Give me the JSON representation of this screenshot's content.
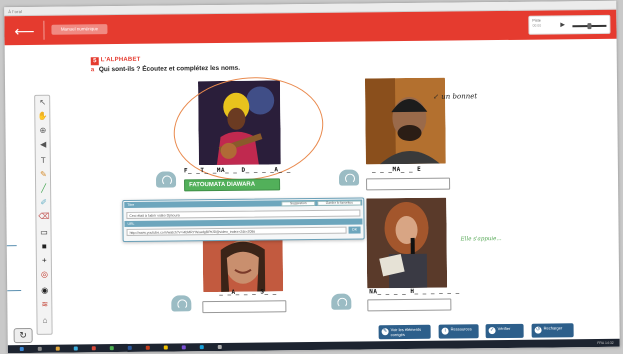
{
  "window": {
    "titlebar_text": "À l'oral"
  },
  "appbar": {
    "back_label": "⟵",
    "nav_chip_label": "Manuel numérique",
    "media": {
      "label_top": "Piste",
      "label_bottom": "00:00",
      "play": "▶"
    }
  },
  "toolbar": {
    "tools": [
      {
        "name": "cursor-icon",
        "glyph": "↖"
      },
      {
        "name": "hand-icon",
        "glyph": "✋"
      },
      {
        "name": "zoom-icon",
        "glyph": "⊕"
      },
      {
        "name": "speaker-tool-icon",
        "glyph": "◀"
      },
      {
        "name": "text-icon",
        "glyph": "T"
      },
      {
        "name": "pencil-icon",
        "glyph": "✎"
      },
      {
        "name": "marker-icon",
        "glyph": "╱"
      },
      {
        "name": "highlighter-icon",
        "glyph": "✐"
      },
      {
        "name": "eraser-icon",
        "glyph": "⌫"
      },
      {
        "name": "screen-icon",
        "glyph": "▭"
      },
      {
        "name": "square-icon",
        "glyph": "■"
      },
      {
        "name": "plus-icon",
        "glyph": "+"
      },
      {
        "name": "target-icon",
        "glyph": "◎"
      },
      {
        "name": "eye-icon",
        "glyph": "◉"
      },
      {
        "name": "mask-icon",
        "glyph": "≋"
      },
      {
        "name": "save-icon",
        "glyph": "⌂"
      }
    ]
  },
  "exercise": {
    "number": "5",
    "title": "L'ALPHABET",
    "arrow": "a",
    "instruction": "Qui sont-ils ? Écoutez et complétez les noms."
  },
  "cards": [
    {
      "dashed": "F_ _T_ _MA_ _ D_ _ _ _A_ _",
      "answer": "FATOUMATA DIAWARA",
      "correct": true
    },
    {
      "dashed": "_ _ _MA_ _ E",
      "answer": "",
      "correct": false
    },
    {
      "dashed": "_ _A_ _ _ S_ _",
      "answer": "",
      "correct": false
    },
    {
      "dashed": "NA_ _ _ _ H_ _ _ _ _ _",
      "answer": "",
      "correct": false
    }
  ],
  "notes": {
    "handwritten": "↙ un bonnet",
    "green": "Elle s'appuie..."
  },
  "popup": {
    "bar1_label": "Titre",
    "btn1": "Suggestion",
    "btn2": "Garder le favorites",
    "field1": "Ceci était à l'abrir vidéo Djinoura",
    "bar2_label": "URL",
    "field2": "http://www.youtube.com/watch?v=i4bMRYWxadgBPKSl@video_index=2&t=208s",
    "go": "OK"
  },
  "corner_button": "↻",
  "footer": [
    {
      "label": "Voir les éléments corrigés",
      "icon": "✎"
    },
    {
      "label": "Ressources",
      "icon": "i"
    },
    {
      "label": "Vérifier",
      "icon": "✓"
    },
    {
      "label": "Recharger",
      "icon": "↺"
    }
  ],
  "taskbar": {
    "tray": "FRA 14:32"
  },
  "colors": {
    "appbar": "#e53b2f",
    "accent_red": "#e53b2f",
    "correct_green": "#52b05a",
    "popup_blue": "#6da6bd",
    "footer_blue": "#2d5f8b"
  }
}
